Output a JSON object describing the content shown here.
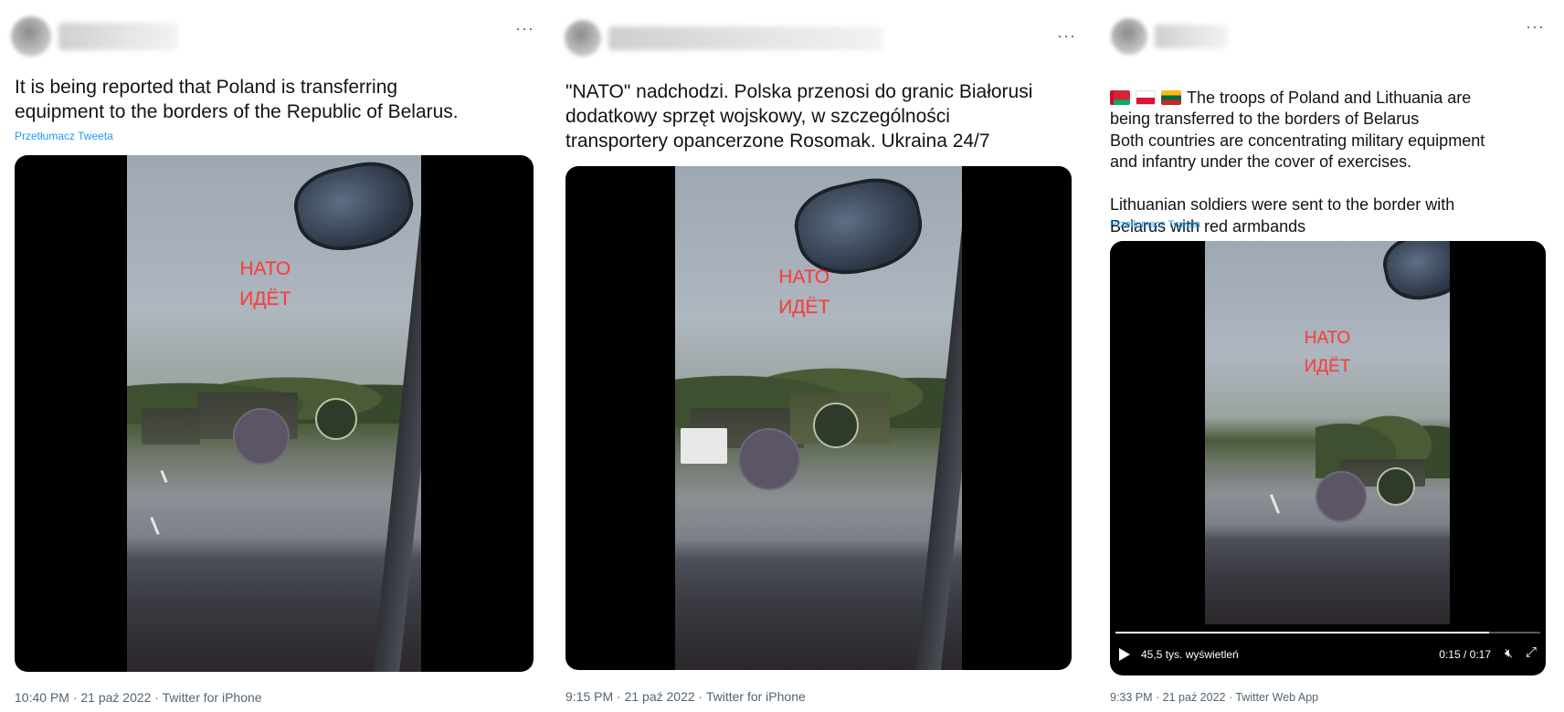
{
  "tweets": [
    {
      "more": "···",
      "text": "It is being reported that Poland is transferring\nequipment to the borders of the Republic of Belarus.",
      "translate": "Przetłumacz Tweeta",
      "overlay_line1": "НАТО",
      "overlay_line2": "ИДЁТ",
      "meta": "10:40 PM · 21 paź 2022 · Twitter for iPhone"
    },
    {
      "more": "···",
      "text": "\"NATO\" nadchodzi. Polska przenosi do granic Białorusi\ndodatkowy sprzęt wojskowy, w szczególności\ntransportery opancerzone Rosomak. Ukraina 24/7",
      "overlay_line1": "НАТО",
      "overlay_line2": "ИДЁТ",
      "meta": "9:15 PM · 21 paź 2022 · Twitter for iPhone"
    },
    {
      "more": "···",
      "flags": [
        "belarus-flag",
        "poland-flag",
        "lithuania-flag"
      ],
      "text_line1": "The troops of Poland and Lithuania are",
      "text_rest": "being transferred to the borders of Belarus\nBoth countries are concentrating military equipment\nand infantry under the cover of exercises.\n\nLithuanian soldiers were sent to the border with\nBelarus with red armbands",
      "translate": "Przetłumacz Tweeta",
      "overlay_line1": "НАТО",
      "overlay_line2": "ИДЁТ",
      "video": {
        "views": "45,5 tys. wyświetleń",
        "time": "0:15 / 0:17",
        "progress": 0.88,
        "play_icon": "play-icon",
        "mute_icon": "mute-icon",
        "fullscreen_icon": "fullscreen-icon"
      },
      "meta": "9:33 PM · 21 paź 2022 · Twitter Web App"
    }
  ],
  "colors": {
    "link": "#1d9bf0",
    "meta": "#536471",
    "overlay_text": "#ff3b3b"
  }
}
